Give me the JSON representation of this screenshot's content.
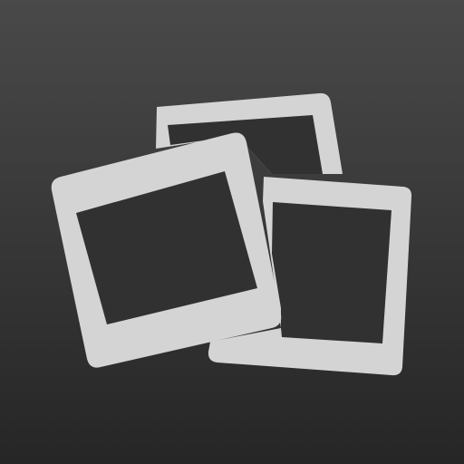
{
  "icon": {
    "name": "photo-slides-app-icon",
    "background_top": "#494949",
    "background_bottom": "#262626",
    "frame_color": "#d4d4d4",
    "window_color": "#313131"
  }
}
